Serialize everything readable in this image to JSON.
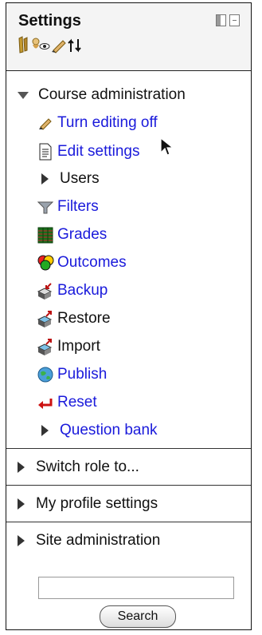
{
  "block": {
    "title": "Settings",
    "dock_icon": "dock-toggle-icon",
    "toolbar_icons": [
      "move-icon",
      "show-hide-icon",
      "edit-icon",
      "permissions-icon"
    ]
  },
  "course_admin": {
    "heading": "Course administration",
    "items": [
      {
        "label": "Turn editing off",
        "icon": "pencil-icon"
      },
      {
        "label": "Edit settings",
        "icon": "document-icon"
      },
      {
        "label": "Users",
        "icon": "expand-arrow-icon"
      },
      {
        "label": "Filters",
        "icon": "funnel-icon"
      },
      {
        "label": "Grades",
        "icon": "grades-table-icon"
      },
      {
        "label": "Outcomes",
        "icon": "outcomes-circles-icon"
      },
      {
        "label": "Backup",
        "icon": "backup-box-icon"
      },
      {
        "label": "Restore",
        "icon": "restore-box-icon"
      },
      {
        "label": "Import",
        "icon": "import-box-icon"
      },
      {
        "label": "Publish",
        "icon": "publish-globe-icon"
      },
      {
        "label": "Reset",
        "icon": "reset-arrow-icon"
      },
      {
        "label": "Question bank",
        "icon": "expand-arrow-icon"
      }
    ]
  },
  "sections": [
    {
      "label": "Switch role to..."
    },
    {
      "label": "My profile settings"
    },
    {
      "label": "Site administration"
    }
  ],
  "search": {
    "value": "",
    "button_label": "Search"
  },
  "colors": {
    "link": "#1a1adb",
    "text": "#111111",
    "header_bg": "#f4f4f4"
  }
}
